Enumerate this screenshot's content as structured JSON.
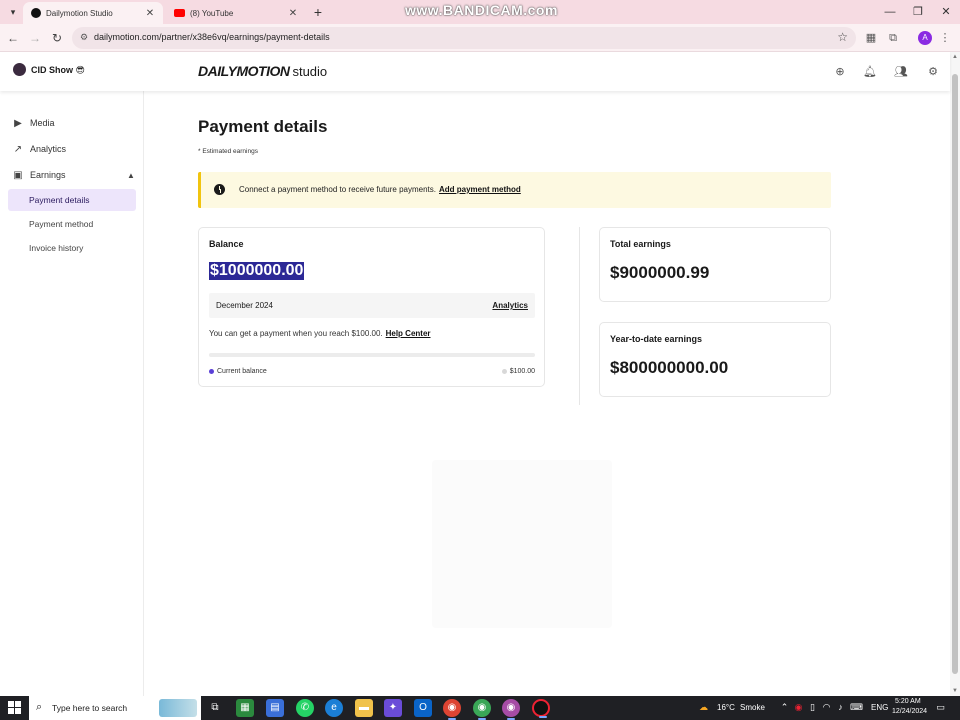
{
  "browser": {
    "tabs": [
      {
        "label": "Dailymotion Studio",
        "active": true
      },
      {
        "label": "(8) YouTube",
        "active": false
      }
    ],
    "watermark": "www.BANDICAM.com",
    "url": "dailymotion.com/partner/x38e6vq/earnings/payment-details",
    "profile_initial": "A"
  },
  "header": {
    "channel_name": "CID Show 😎",
    "logo": "DAILYMOTION",
    "logo_suffix": "studio"
  },
  "sidebar": {
    "items": [
      {
        "label": "Media",
        "icon": "play-square-icon"
      },
      {
        "label": "Analytics",
        "icon": "trend-up-icon"
      },
      {
        "label": "Earnings",
        "icon": "earnings-icon",
        "expanded": true
      }
    ],
    "subitems": [
      {
        "label": "Payment details",
        "active": true
      },
      {
        "label": "Payment method",
        "active": false
      },
      {
        "label": "Invoice history",
        "active": false
      }
    ]
  },
  "main": {
    "title": "Payment details",
    "note": "* Estimated earnings",
    "alert": {
      "text": "Connect a payment method to receive future payments.",
      "link": "Add payment method",
      "color": "#f1c40f"
    },
    "balance": {
      "label": "Balance",
      "amount": "$1000000.00",
      "period": "December 2024",
      "analytics_link": "Analytics",
      "threshold_text": "You can get a payment when you reach $100.00.",
      "help_link": "Help Center",
      "progress_fraction": 0,
      "legend_current": "Current balance",
      "legend_goal": "$100.00"
    },
    "total_earnings": {
      "label": "Total earnings",
      "amount": "$9000000.99"
    },
    "ytd_earnings": {
      "label": "Year-to-date earnings",
      "amount": "$800000000.00"
    },
    "accent_color": "#5a3fd6"
  },
  "taskbar": {
    "search_placeholder": "Type here to search",
    "weather_temp": "16°C",
    "weather_text": "Smoke",
    "language": "ENG",
    "time": "5:20 AM",
    "date": "12/24/2024"
  }
}
